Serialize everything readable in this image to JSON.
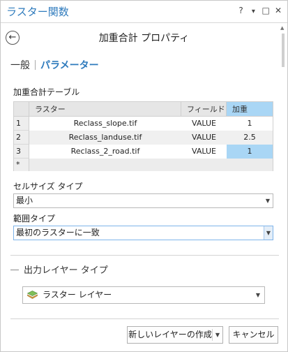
{
  "window": {
    "title": "ラスター関数",
    "help": "?",
    "menu_arrow": "▾",
    "restore": "□",
    "close": "✕"
  },
  "header": {
    "back_icon": "←",
    "title": "加重合計 プロパティ"
  },
  "tabs": [
    {
      "label": "一般",
      "active": false
    },
    {
      "label": "パラメーター",
      "active": true
    }
  ],
  "table": {
    "label": "加重合計テーブル",
    "columns": [
      "ラスター",
      "フィールド",
      "加重"
    ],
    "rows": [
      {
        "num": "1",
        "raster": "Reclass_slope.tif",
        "field": "VALUE",
        "weight": "1"
      },
      {
        "num": "2",
        "raster": "Reclass_landuse.tif",
        "field": "VALUE",
        "weight": "2.5"
      },
      {
        "num": "3",
        "raster": "Reclass_2_road.tif",
        "field": "VALUE",
        "weight": "1"
      }
    ],
    "new_row_marker": "*"
  },
  "cell_size_type": {
    "label": "セルサイズ タイプ",
    "value": "最小"
  },
  "extent_type": {
    "label": "範囲タイプ",
    "value": "最初のラスターに一致"
  },
  "output": {
    "section_label": "出力レイヤー タイプ",
    "layer_type": "ラスター レイヤー",
    "layer_icon": "raster-layer-icon"
  },
  "footer": {
    "create_label": "新しいレイヤーの作成",
    "cancel_label": "キャンセル"
  },
  "colors": {
    "accent": "#2f7bbd",
    "selected_cell": "#a9d6f5"
  }
}
